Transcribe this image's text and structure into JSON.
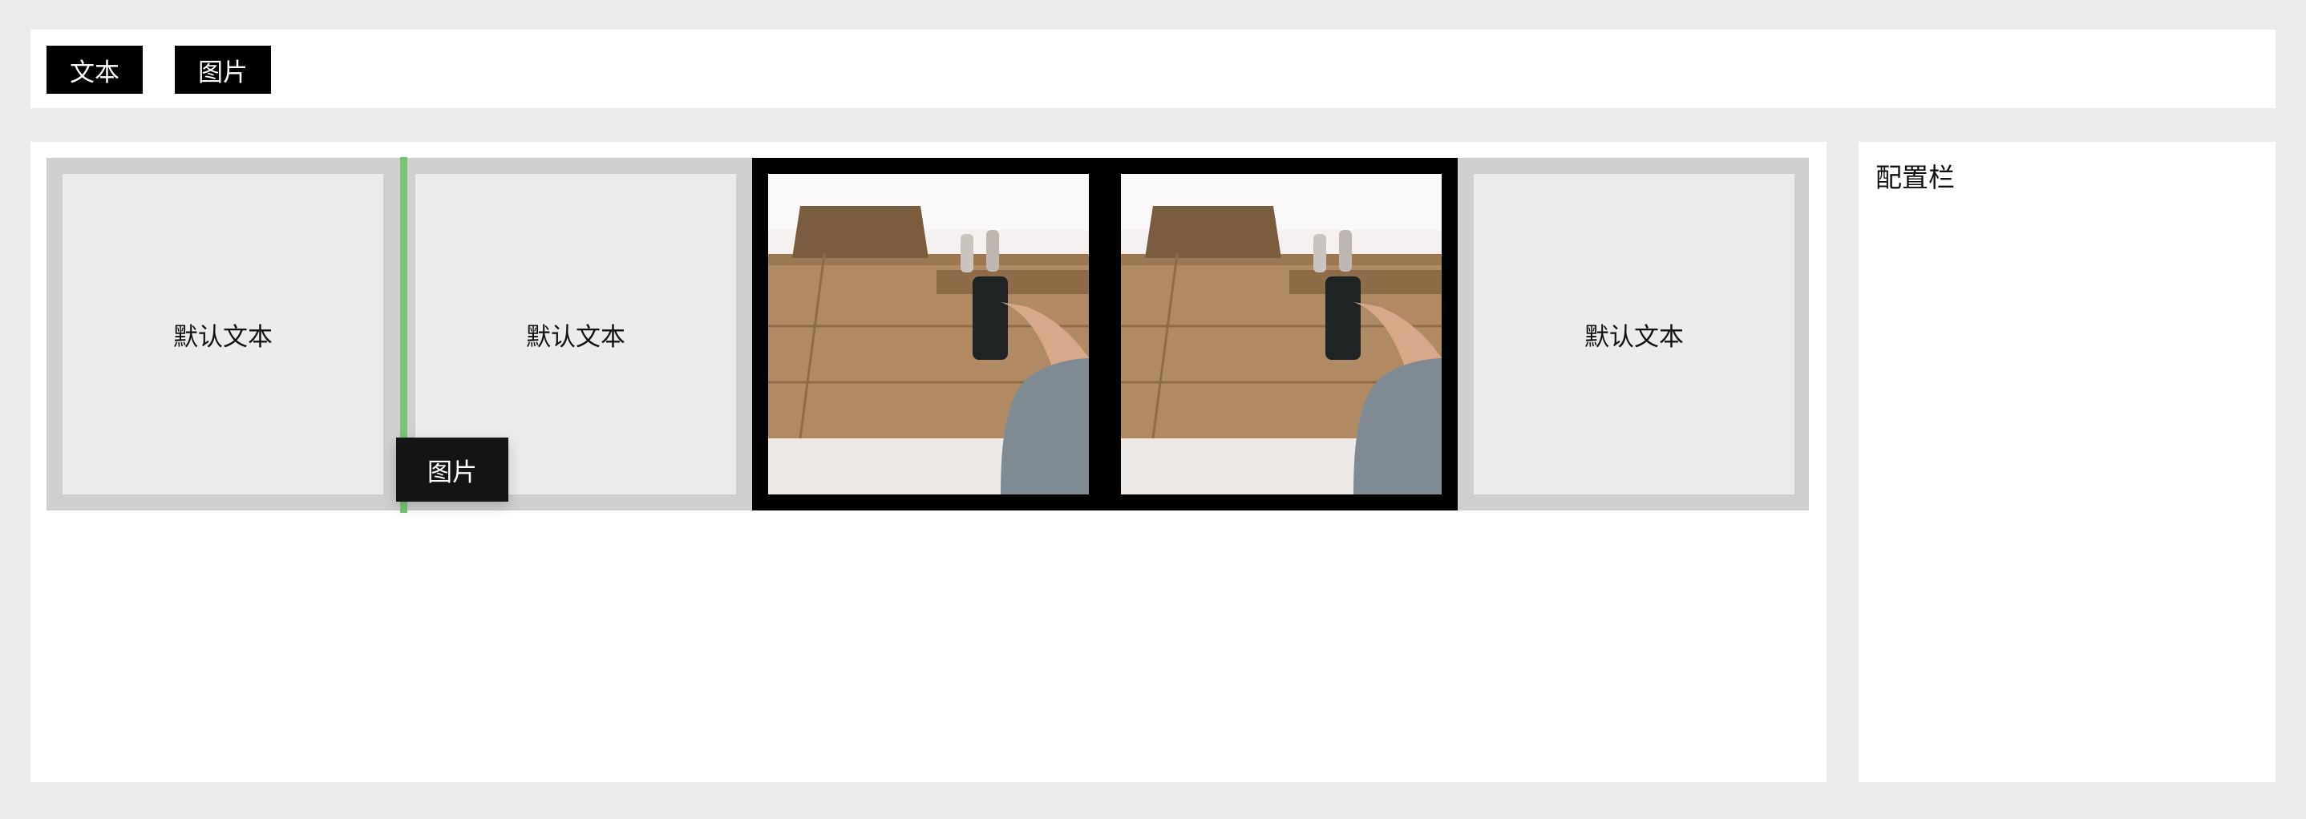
{
  "toolbar": {
    "text_label": "文本",
    "image_label": "图片"
  },
  "canvas": {
    "items": [
      {
        "type": "text",
        "label": "默认文本"
      },
      {
        "type": "text",
        "label": "默认文本"
      },
      {
        "type": "image",
        "selected": true
      },
      {
        "type": "image",
        "selected": true
      },
      {
        "type": "text",
        "label": "默认文本"
      }
    ],
    "drag_ghost_label": "图片"
  },
  "config_panel": {
    "title": "配置栏"
  },
  "colors": {
    "page_bg": "#ececec",
    "button_bg": "#000000",
    "drop_indicator": "#79c276",
    "strip_bg": "#cfcfcf"
  }
}
